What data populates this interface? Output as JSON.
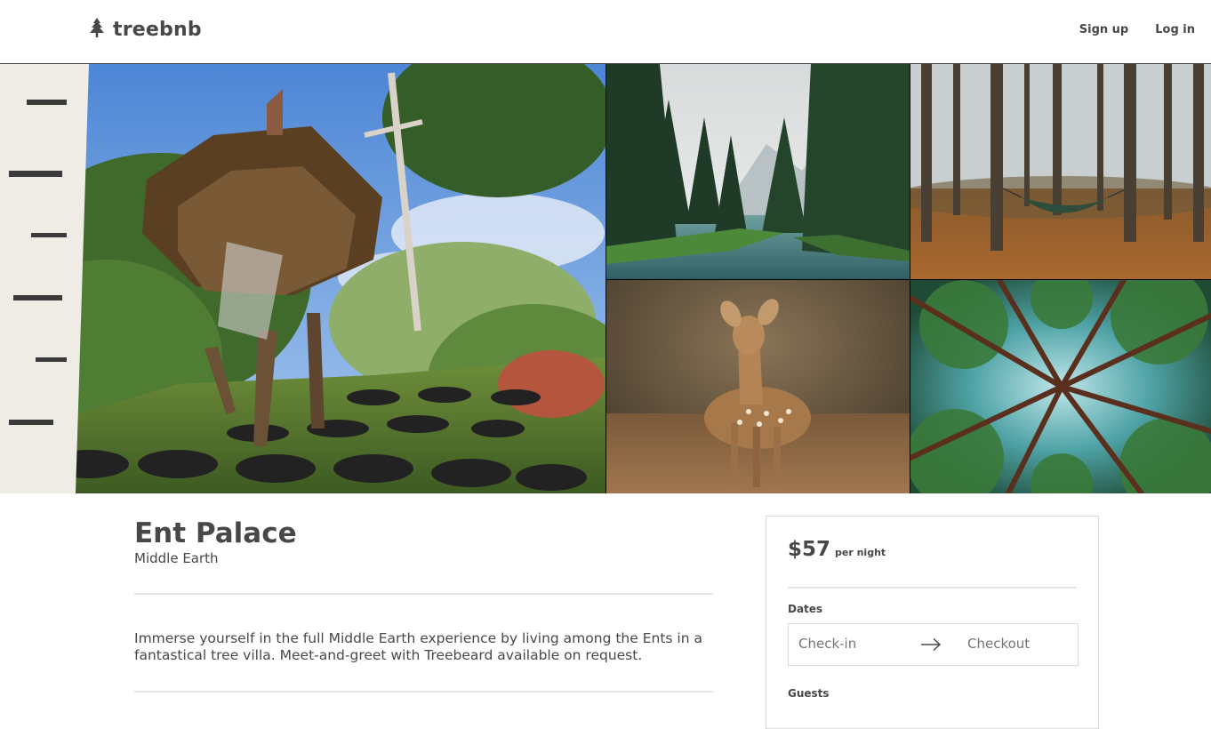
{
  "brand": {
    "name": "treebnb",
    "icon": "tree-icon"
  },
  "nav": {
    "signup_label": "Sign up",
    "login_label": "Log in"
  },
  "gallery": {
    "photos": [
      {
        "name": "treehouse-photo"
      },
      {
        "name": "forest-lake-photo"
      },
      {
        "name": "hammock-forest-photo"
      },
      {
        "name": "deer-photo"
      },
      {
        "name": "tree-canopy-photo"
      }
    ]
  },
  "listing": {
    "title": "Ent Palace",
    "location": "Middle Earth",
    "description": "Immerse yourself in the full Middle Earth experience by living among the Ents in a fantastical tree villa. Meet-and-greet with Treebeard available on request."
  },
  "booking": {
    "price": "$57",
    "price_unit": "per night",
    "dates_label": "Dates",
    "checkin_placeholder": "Check-in",
    "checkout_placeholder": "Checkout",
    "arrow_icon": "arrow-right-icon",
    "guests_label": "Guests"
  },
  "colors": {
    "text": "#484848",
    "divider": "#e6e6e6",
    "border": "#dcdcdc"
  }
}
